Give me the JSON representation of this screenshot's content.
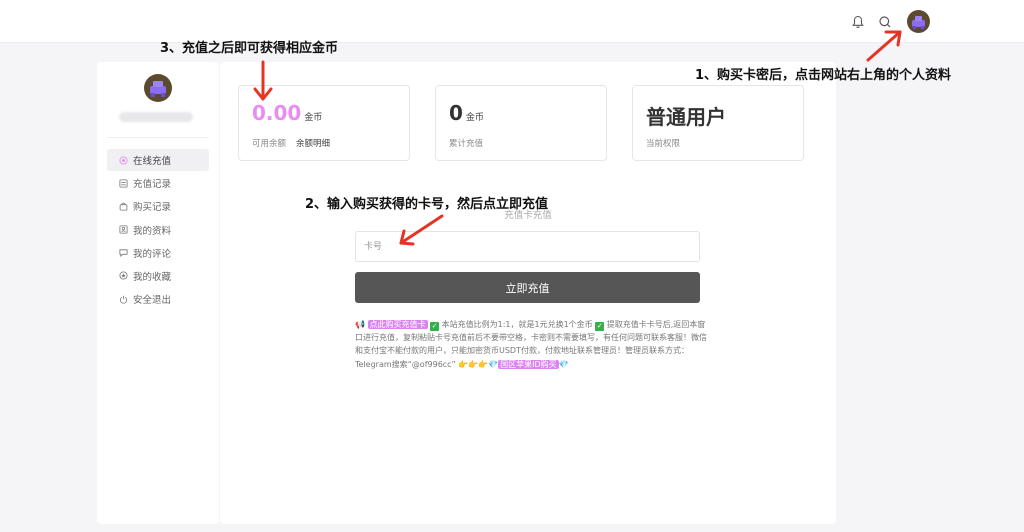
{
  "topbar": {
    "icons": [
      "bell-icon",
      "search-icon",
      "avatar"
    ]
  },
  "sidebar": {
    "items": [
      {
        "label": "在线充值",
        "icon": "coin-icon",
        "active": true
      },
      {
        "label": "充值记录",
        "icon": "list-icon",
        "active": false
      },
      {
        "label": "购买记录",
        "icon": "bag-icon",
        "active": false
      },
      {
        "label": "我的资料",
        "icon": "profile-icon",
        "active": false
      },
      {
        "label": "我的评论",
        "icon": "comment-icon",
        "active": false
      },
      {
        "label": "我的收藏",
        "icon": "star-icon",
        "active": false
      },
      {
        "label": "安全退出",
        "icon": "power-icon",
        "active": false
      }
    ]
  },
  "stats": {
    "balance": {
      "value": "0.00",
      "unit": "金币",
      "label": "可用余额",
      "link": "余额明细"
    },
    "total": {
      "value": "0",
      "unit": "金币",
      "label": "累计充值"
    },
    "role": {
      "value": "普通用户",
      "label": "当前权限"
    }
  },
  "recharge": {
    "title": "充值卡充值",
    "placeholder": "卡号",
    "button": "立即充值"
  },
  "notice": {
    "hl1": "点此购买充值卡",
    "text1": "本站充值比例为1:1，就是1元兑换1个金币",
    "text2": "提取充值卡卡号后,返回本窗口进行充值，复制粘贴卡号充值前后不要带空格，卡密则不需要填写，有任何问题可联系客服！微信和支付宝不能付款的用户，只能加密货币USDT付款，付款地址联系管理员！管理员联系方式：Telegram搜索“@of996cc”",
    "hl2": "国区苹果ID购买"
  },
  "annotations": {
    "a1": "1、购买卡密后，点击网站右上角的个人资料",
    "a2": "2、输入购买获得的卡号，然后点立即充值",
    "a3": "3、充值之后即可获得相应金币"
  },
  "colors": {
    "accent": "#ea8cf3",
    "button": "#565656",
    "arrow": "#e53325"
  }
}
